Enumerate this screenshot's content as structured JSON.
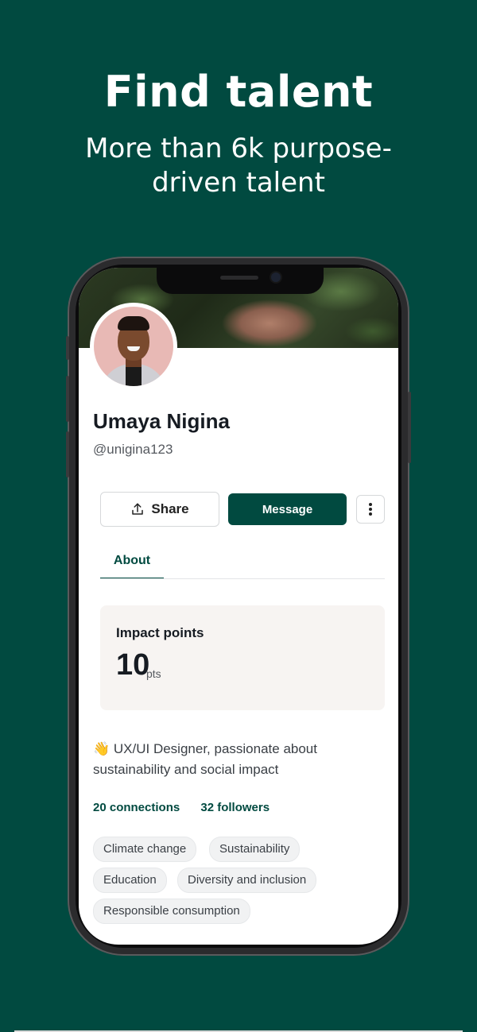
{
  "hero": {
    "title": "Find talent",
    "subtitle": "More than 6k purpose-driven talent"
  },
  "profile": {
    "name": "Umaya Nigina",
    "handle": "@unigina123",
    "share_label": "Share",
    "message_label": "Message",
    "tabs": [
      {
        "label": "About"
      }
    ],
    "impact": {
      "title": "Impact points",
      "value": "10",
      "unit": "pts"
    },
    "bio": "👋 UX/UI Designer, passionate about sustainability and social impact",
    "connections": "20 connections",
    "followers": "32 followers",
    "interests": [
      "Climate change",
      "Sustainability",
      "Education",
      "Diversity and inclusion",
      "Responsible consumption"
    ]
  },
  "colors": {
    "brand": "#014a40",
    "background": "#014a40",
    "card": "#f7f4f2"
  },
  "icons": [
    "share-icon",
    "more-vertical-icon"
  ]
}
